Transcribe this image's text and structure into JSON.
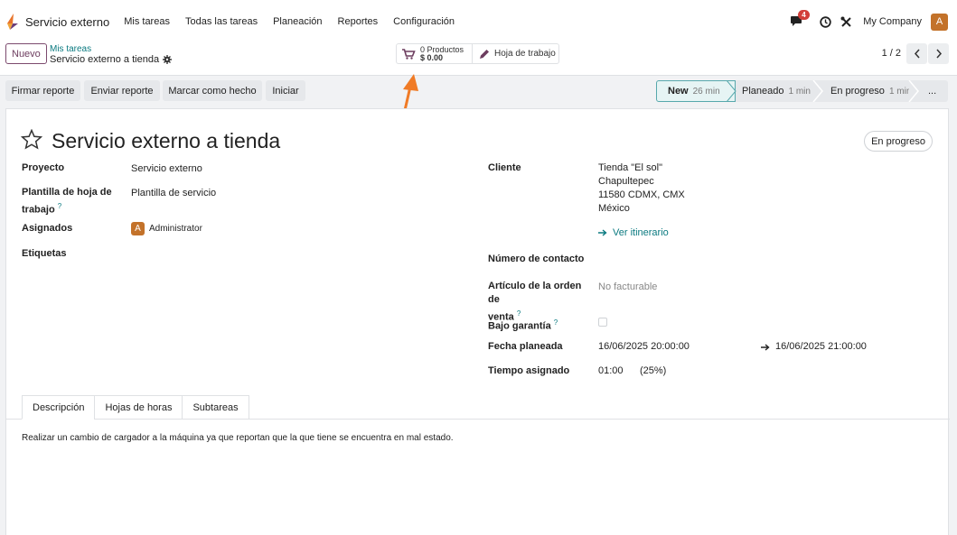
{
  "topbar": {
    "app_name": "Servicio externo",
    "menu": [
      "Mis tareas",
      "Todas las tareas",
      "Planeación",
      "Reportes",
      "Configuración"
    ],
    "chat_count": "4",
    "company": "My Company",
    "user_initial": "A"
  },
  "control_panel": {
    "new_label": "Nuevo",
    "breadcrumb_parent": "Mis tareas",
    "breadcrumb_current": "Servicio externo a tienda",
    "products_count": "0 Productos",
    "products_amount": "$ 0.00",
    "worksheet_label": "Hoja de trabajo",
    "pager": "1 / 2"
  },
  "actions": [
    "Firmar reporte",
    "Enviar reporte",
    "Marcar como hecho",
    "Iniciar"
  ],
  "stages": [
    {
      "name": "New",
      "mins": "26 min"
    },
    {
      "name": "Planeado",
      "mins": "1 min"
    },
    {
      "name": "En progreso",
      "mins": "1 min"
    },
    {
      "name": "...",
      "mins": ""
    }
  ],
  "record": {
    "title": "Servicio externo a tienda",
    "state_badge": "En progreso",
    "fields_left": {
      "project_label": "Proyecto",
      "project_value": "Servicio externo",
      "template_label_1": "Plantilla de hoja de",
      "template_label_2": "trabajo",
      "template_value": "Plantilla de servicio",
      "assignees_label": "Asignados",
      "assignee_initial": "A",
      "assignee_name": "Administrator",
      "tags_label": "Etiquetas"
    },
    "fields_right": {
      "client_label": "Cliente",
      "client_lines": [
        "Tienda \"El sol\"",
        "Chapultepec",
        "11580 CDMX, CMX",
        "México"
      ],
      "itinerary_link": "Ver itinerario",
      "contact_label": "Número de contacto",
      "so_item_label_1": "Artículo de la orden de",
      "so_item_label_2": "venta",
      "so_item_value": "No facturable",
      "warranty_label": "Bajo garantía",
      "planned_label": "Fecha planeada",
      "planned_start": "16/06/2025 20:00:00",
      "planned_end": "16/06/2025 21:00:00",
      "allocated_label": "Tiempo asignado",
      "allocated_value": "01:00",
      "allocated_pct": "(25%)"
    },
    "help_mark": "?"
  },
  "tabs": [
    "Descripción",
    "Hojas de horas",
    "Subtareas"
  ],
  "description": "Realizar un cambio de cargador a la máquina ya que reportan que la que tiene se encuentra en mal estado."
}
